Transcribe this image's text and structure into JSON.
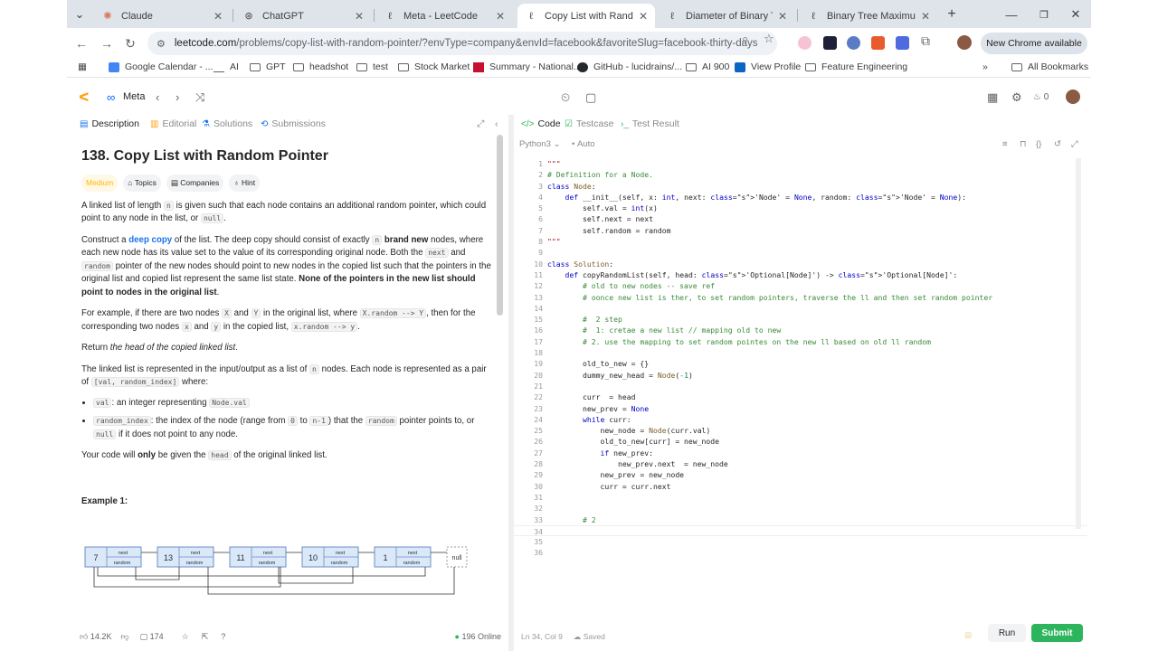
{
  "browser": {
    "tabs": [
      {
        "title": "Claude",
        "icon": "claude-logo-icon"
      },
      {
        "title": "ChatGPT",
        "icon": "chatgpt-logo-icon"
      },
      {
        "title": "Meta - LeetCode",
        "icon": "leetcode-logo-icon"
      },
      {
        "title": "Copy List with Random Po",
        "icon": "leetcode-logo-icon",
        "active": true
      },
      {
        "title": "Diameter of Binary Tree -",
        "icon": "leetcode-logo-icon"
      },
      {
        "title": "Binary Tree Maximum Path",
        "icon": "leetcode-logo-icon"
      }
    ],
    "url_host": "leetcode.com",
    "url_path": "/problems/copy-list-with-random-pointer/?envType=company&envId=facebook&favoriteSlug=facebook-thirty-days",
    "new_chrome_label": "New Chrome available",
    "bookmarks": [
      "Google Calendar - ...",
      "AI",
      "GPT",
      "headshot",
      "test",
      "Stock Market",
      "Summary - National...",
      "GitHub - lucidrains/...",
      "AI 900",
      "View Profile",
      "Feature Engineering"
    ],
    "all_bookmarks": "All Bookmarks"
  },
  "lc_header": {
    "company": "Meta",
    "streak": "0"
  },
  "left_tabs": [
    "Description",
    "Editorial",
    "Solutions",
    "Submissions"
  ],
  "problem": {
    "title": "138. Copy List with Random Pointer",
    "difficulty": "Medium",
    "chips": [
      "Topics",
      "Companies",
      "Hint"
    ],
    "p1_a": "A linked list of length",
    "p1_n": "n",
    "p1_b": "is given such that each node contains an additional random pointer, which could point to any node in the list, or",
    "p1_null": "null",
    "p2_a": "Construct a",
    "p2_link": "deep copy",
    "p2_b": "of the list. The deep copy should consist of exactly",
    "p2_n": "n",
    "p2_bold": "brand new",
    "p2_c": "nodes, where each new node has its value set to the value of its corresponding original node. Both the",
    "p2_next": "next",
    "p2_and": "and",
    "p2_random": "random",
    "p2_d": "pointer of the new nodes should point to new nodes in the copied list such that the pointers in the original list and copied list represent the same list state.",
    "p2_bold2": "None of the pointers in the new list should point to nodes in the original list",
    "p3_a": "For example, if there are two nodes",
    "p3_x": "X",
    "p3_and": "and",
    "p3_y": "Y",
    "p3_b": "in the original list, where",
    "p3_xr": "X.random --> Y",
    "p3_c": ", then for the corresponding two nodes",
    "p3_x2": "x",
    "p3_and2": "and",
    "p3_y2": "y",
    "p3_d": "in the copied list,",
    "p3_xr2": "x.random --> y",
    "p4_a": "Return",
    "p4_i": "the head of the copied linked list",
    "p5_a": "The linked list is represented in the input/output as a list of",
    "p5_n": "n",
    "p5_b": "nodes. Each node is represented as a pair of",
    "p5_pair": "[val, random_index]",
    "p5_c": "where:",
    "li1_code": "val",
    "li1_a": ": an integer representing",
    "li1_b": "Node.val",
    "li2_code": "random_index",
    "li2_a": ": the index of the node (range from",
    "li2_0": "0",
    "li2_to": "to",
    "li2_n1": "n-1",
    "li2_b": ") that the",
    "li2_random": "random",
    "li2_c": "pointer points to, or",
    "li2_null": "null",
    "li2_d": "if it does not point to any node.",
    "p6_a": "Your code will",
    "p6_bold": "only",
    "p6_b": "be given the",
    "p6_head": "head",
    "p6_c": "of the original linked list.",
    "example_label": "Example 1:",
    "diagram_nodes": [
      "7",
      "13",
      "11",
      "10",
      "1"
    ],
    "diagram_next": "next",
    "diagram_random": "random",
    "diagram_null": "null"
  },
  "left_footer": {
    "likes": "14.2K",
    "comments": "174",
    "online": "196 Online"
  },
  "right_tabs": [
    "Code",
    "Testcase",
    "Test Result"
  ],
  "editor": {
    "language": "Python3",
    "mode": "Auto",
    "status": "Ln 34, Col 9",
    "saved": "Saved",
    "run": "Run",
    "submit": "Submit"
  },
  "code_lines": [
    "\"\"\"",
    "# Definition for a Node.",
    "class Node:",
    "    def __init__(self, x: int, next: 'Node' = None, random: 'Node' = None):",
    "        self.val = int(x)",
    "        self.next = next",
    "        self.random = random",
    "\"\"\"",
    "",
    "class Solution:",
    "    def copyRandomList(self, head: 'Optional[Node]') -> 'Optional[Node]':",
    "        # old to new nodes -- save ref",
    "        # oonce new list is ther, to set random pointers, traverse the ll and then set random pointer",
    "",
    "        #  2 step",
    "        #  1: cretae a new list // mapping old to new",
    "        # 2. use the mapping to set random pointes on the new ll based on old ll random",
    "",
    "        old_to_new = {}",
    "        dummy_new_head = Node(-1)",
    "",
    "        curr  = head",
    "        new_prev = None",
    "        while curr:",
    "            new_node = Node(curr.val)",
    "            old_to_new[curr] = new_node",
    "            if new_prev:",
    "                new_prev.next  = new_node",
    "            new_prev = new_node",
    "            curr = curr.next",
    "",
    "",
    "        # 2",
    "",
    "",
    ""
  ]
}
